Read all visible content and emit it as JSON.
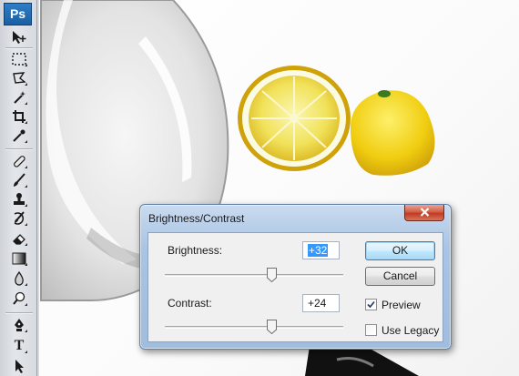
{
  "app": {
    "logo_text": "Ps"
  },
  "tools": [
    {
      "name": "move-tool",
      "icon": "move-icon"
    },
    {
      "name": "marquee-tool",
      "icon": "rectangular-marquee-icon"
    },
    {
      "name": "lasso-tool",
      "icon": "lasso-icon"
    },
    {
      "name": "magic-wand-tool",
      "icon": "magic-wand-icon"
    },
    {
      "name": "crop-tool",
      "icon": "crop-icon"
    },
    {
      "name": "eyedropper-tool",
      "icon": "eyedropper-icon"
    },
    {
      "name": "healing-brush-tool",
      "icon": "bandage-icon"
    },
    {
      "name": "brush-tool",
      "icon": "brush-icon"
    },
    {
      "name": "clone-stamp-tool",
      "icon": "stamp-icon"
    },
    {
      "name": "history-brush-tool",
      "icon": "history-brush-icon"
    },
    {
      "name": "eraser-tool",
      "icon": "eraser-icon"
    },
    {
      "name": "gradient-tool",
      "icon": "gradient-icon"
    },
    {
      "name": "blur-tool",
      "icon": "blur-drop-icon"
    },
    {
      "name": "dodge-tool",
      "icon": "dodge-icon"
    },
    {
      "name": "pen-tool",
      "icon": "pen-icon"
    },
    {
      "name": "type-tool",
      "icon": "type-icon",
      "text": "T"
    },
    {
      "name": "path-selection-tool",
      "icon": "path-selection-icon"
    }
  ],
  "dialog": {
    "title": "Brightness/Contrast",
    "brightness": {
      "label": "Brightness:",
      "value": "+32",
      "slider_fraction": 0.6
    },
    "contrast": {
      "label": "Contrast:",
      "value": "+24",
      "slider_fraction": 0.6
    },
    "ok_label": "OK",
    "cancel_label": "Cancel",
    "preview": {
      "label": "Preview",
      "checked": true
    },
    "use_legacy": {
      "label": "Use Legacy",
      "checked": false
    }
  },
  "colors": {
    "accent_title": "#a9c4e4",
    "selection": "#3399ff",
    "close_button": "#c23a22"
  }
}
